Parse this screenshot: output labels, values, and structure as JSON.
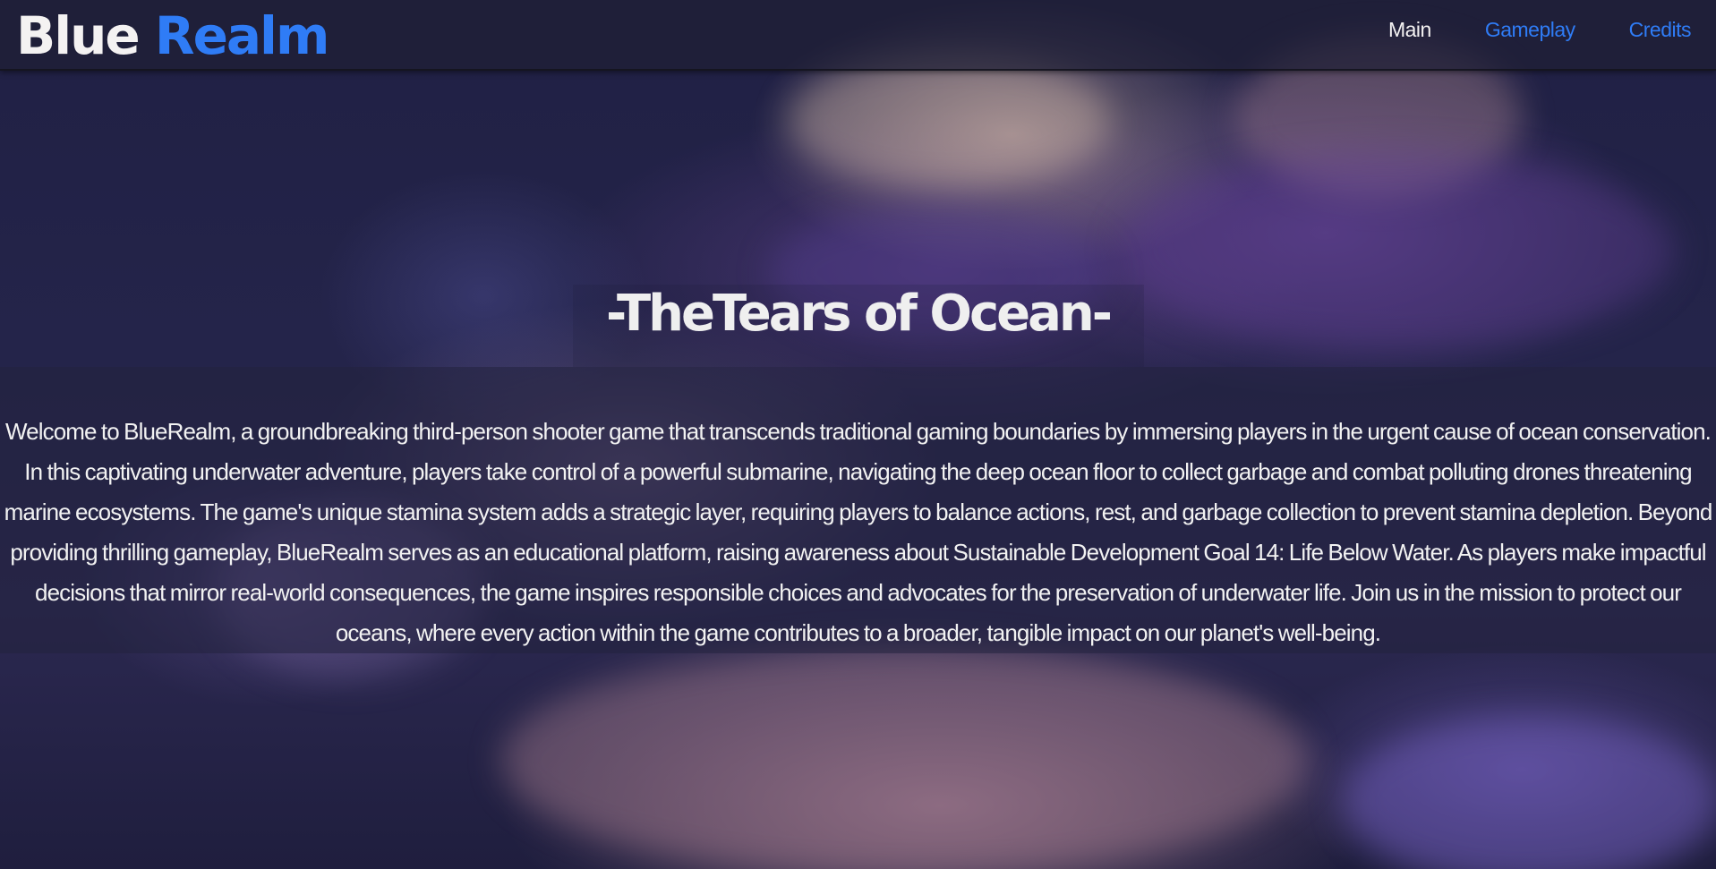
{
  "header": {
    "logo_word1": "Blue",
    "logo_word2": "Realm",
    "nav": [
      {
        "label": "Main",
        "active": true
      },
      {
        "label": "Gameplay",
        "active": false
      },
      {
        "label": "Credits",
        "active": false
      }
    ]
  },
  "hero": {
    "title": "-TheTears of Ocean-",
    "intro": "Welcome to BlueRealm, a groundbreaking third-person shooter game that transcends traditional gaming boundaries by immersing players in the urgent cause of ocean conservation. In this captivating underwater adventure, players take control of a powerful submarine, navigating the deep ocean floor to collect garbage and combat polluting drones threatening marine ecosystems. The game's unique stamina system adds a strategic layer, requiring players to balance actions, rest, and garbage collection to prevent stamina depletion. Beyond providing thrilling gameplay, BlueRealm serves as an educational platform, raising awareness about Sustainable Development Goal 14: Life Below Water. As players make impactful decisions that mirror real-world consequences, the game inspires responsible choices and advocates for the preservation of underwater life. Join us in the mission to protect our oceans, where every action within the game contributes to a broader, tangible impact on our planet's well-being."
  },
  "colors": {
    "accent": "#2f7cf6",
    "text": "#f4f2f2",
    "navbar": "#1e1e34"
  },
  "background": {
    "subject": "coral reef underwater photo"
  }
}
